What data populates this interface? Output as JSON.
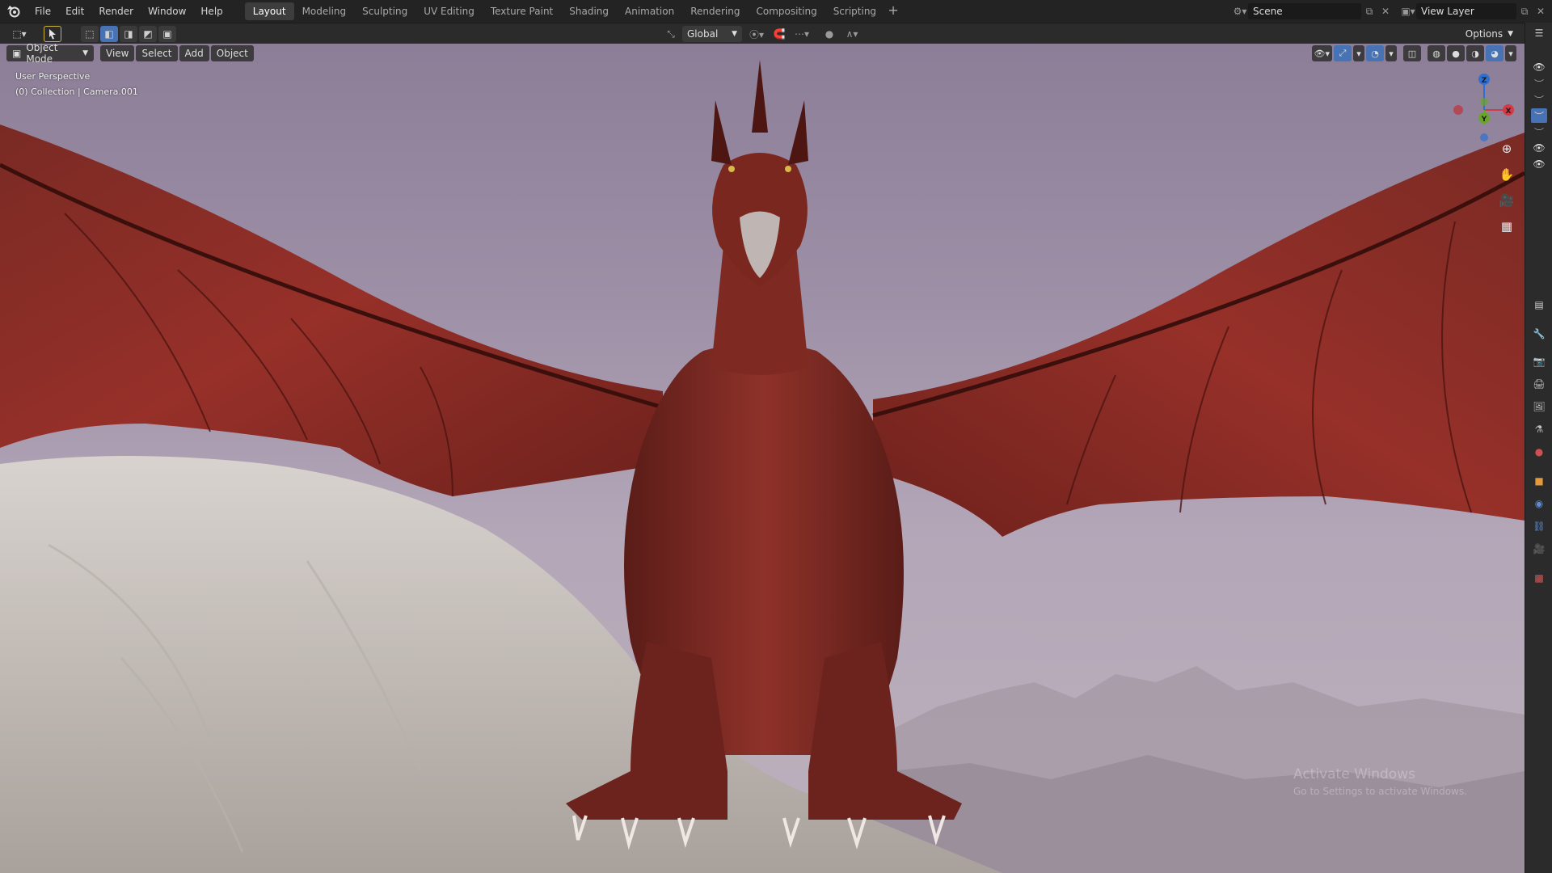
{
  "menu": [
    "File",
    "Edit",
    "Render",
    "Window",
    "Help"
  ],
  "workspaces": [
    {
      "label": "Layout",
      "active": true
    },
    {
      "label": "Modeling"
    },
    {
      "label": "Sculpting"
    },
    {
      "label": "UV Editing"
    },
    {
      "label": "Texture Paint"
    },
    {
      "label": "Shading"
    },
    {
      "label": "Animation"
    },
    {
      "label": "Rendering"
    },
    {
      "label": "Compositing"
    },
    {
      "label": "Scripting"
    }
  ],
  "scene": {
    "name": "Scene",
    "view_layer": "View Layer"
  },
  "toolheader": {
    "orientation": "Global",
    "options_label": "Options"
  },
  "viewport": {
    "mode": "Object Mode",
    "menus": [
      "View",
      "Select",
      "Add",
      "Object"
    ],
    "perspective": "User Perspective",
    "collection_info": "(0) Collection | Camera.001",
    "gizmo_axes": {
      "z": "Z",
      "y": "Y",
      "x": "X"
    }
  },
  "watermark": {
    "line1": "Activate Windows",
    "line2": "Go to Settings to activate Windows."
  },
  "colors": {
    "accent": "#4772b3",
    "topbar": "#232323",
    "header": "#2b2b2b",
    "sky": "#9d8fa6",
    "dragon": "#8a2a22"
  }
}
